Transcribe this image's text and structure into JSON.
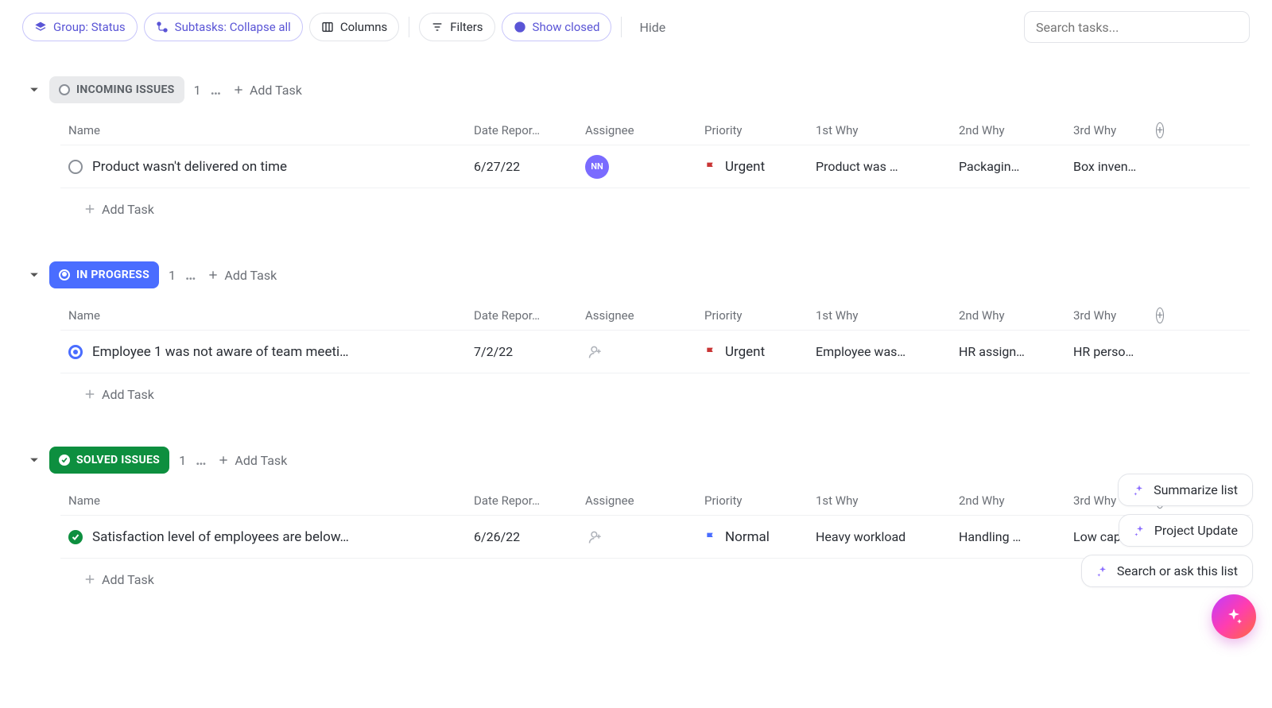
{
  "toolbar": {
    "group": "Group: Status",
    "subtasks": "Subtasks: Collapse all",
    "columns": "Columns",
    "filters": "Filters",
    "show_closed": "Show closed",
    "hide": "Hide",
    "search_placeholder": "Search tasks..."
  },
  "columns": {
    "name": "Name",
    "date": "Date Repor…",
    "assignee": "Assignee",
    "priority": "Priority",
    "why1": "1st Why",
    "why2": "2nd Why",
    "why3": "3rd Why"
  },
  "add_task": {
    "label": "Add Task",
    "row_label": "Add Task"
  },
  "groups": [
    {
      "key": "incoming",
      "status": "INCOMING ISSUES",
      "count": "1",
      "more": "…",
      "task": {
        "title": "Product wasn't delivered on time",
        "date": "6/27/22",
        "assignee": "NN",
        "priority": "Urgent",
        "priority_color": "red",
        "why1": "Product was …",
        "why2": "Packagin…",
        "why3": "Box inven…"
      }
    },
    {
      "key": "progress",
      "status": "IN PROGRESS",
      "count": "1",
      "more": "…",
      "task": {
        "title": "Employee 1 was not aware of team meeti…",
        "date": "7/2/22",
        "assignee": "",
        "priority": "Urgent",
        "priority_color": "red",
        "why1": "Employee was…",
        "why2": "HR assign…",
        "why3": "HR perso…"
      }
    },
    {
      "key": "solved",
      "status": "SOLVED ISSUES",
      "count": "1",
      "more": "…",
      "task": {
        "title": "Satisfaction level of employees are below…",
        "date": "6/26/22",
        "assignee": "",
        "priority": "Normal",
        "priority_color": "blue",
        "why1": "Heavy workload",
        "why2": "Handling …",
        "why3": "Low capa…"
      }
    }
  ],
  "ai": {
    "summarize": "Summarize list",
    "project_update": "Project Update",
    "search_ask": "Search or ask this list"
  }
}
